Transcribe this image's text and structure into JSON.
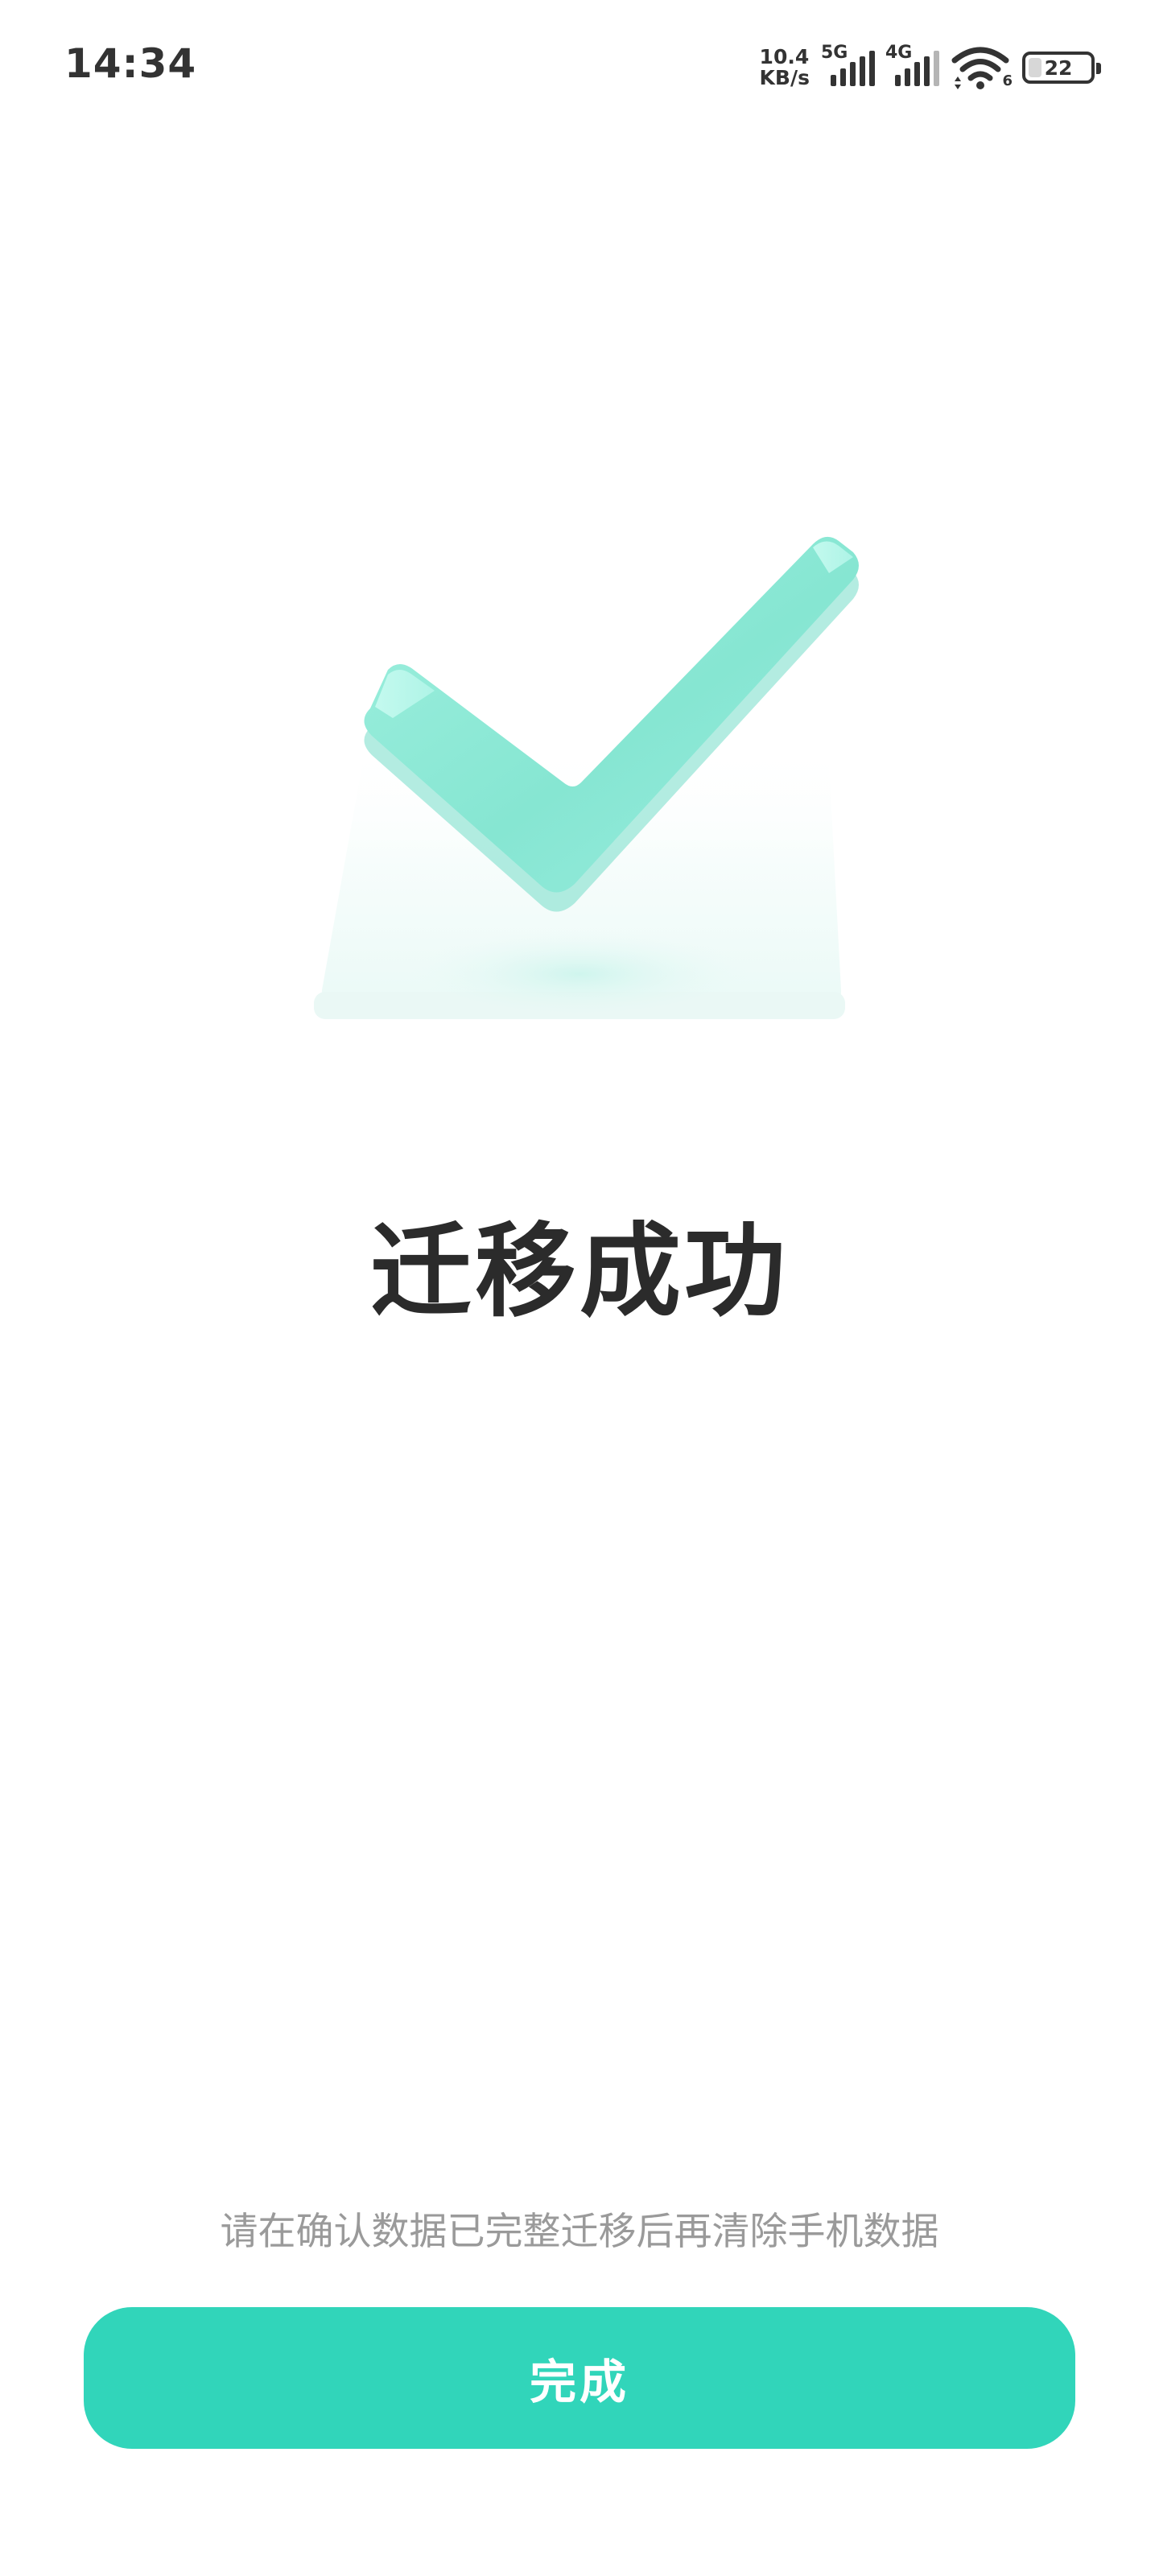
{
  "status_bar": {
    "time": "14:34",
    "net_speed_value": "10.4",
    "net_speed_unit": "KB/s",
    "sim1_type": "5G",
    "sim2_type": "4G",
    "wifi_label": "6",
    "battery_level": "22",
    "battery_fraction": 0.22
  },
  "main": {
    "illustration_icon": "check-mark-success-icon",
    "title": "迁移成功",
    "hint": "请在确认数据已完整迁移后再清除手机数据",
    "done_label": "完成"
  },
  "colors": {
    "accent": "#31d5ba",
    "check_light": "#a5eddf",
    "check_mid": "#7fe3cf",
    "title_text": "#2b2b2b",
    "hint_text": "#9a9a9a",
    "status_text": "#333333"
  }
}
